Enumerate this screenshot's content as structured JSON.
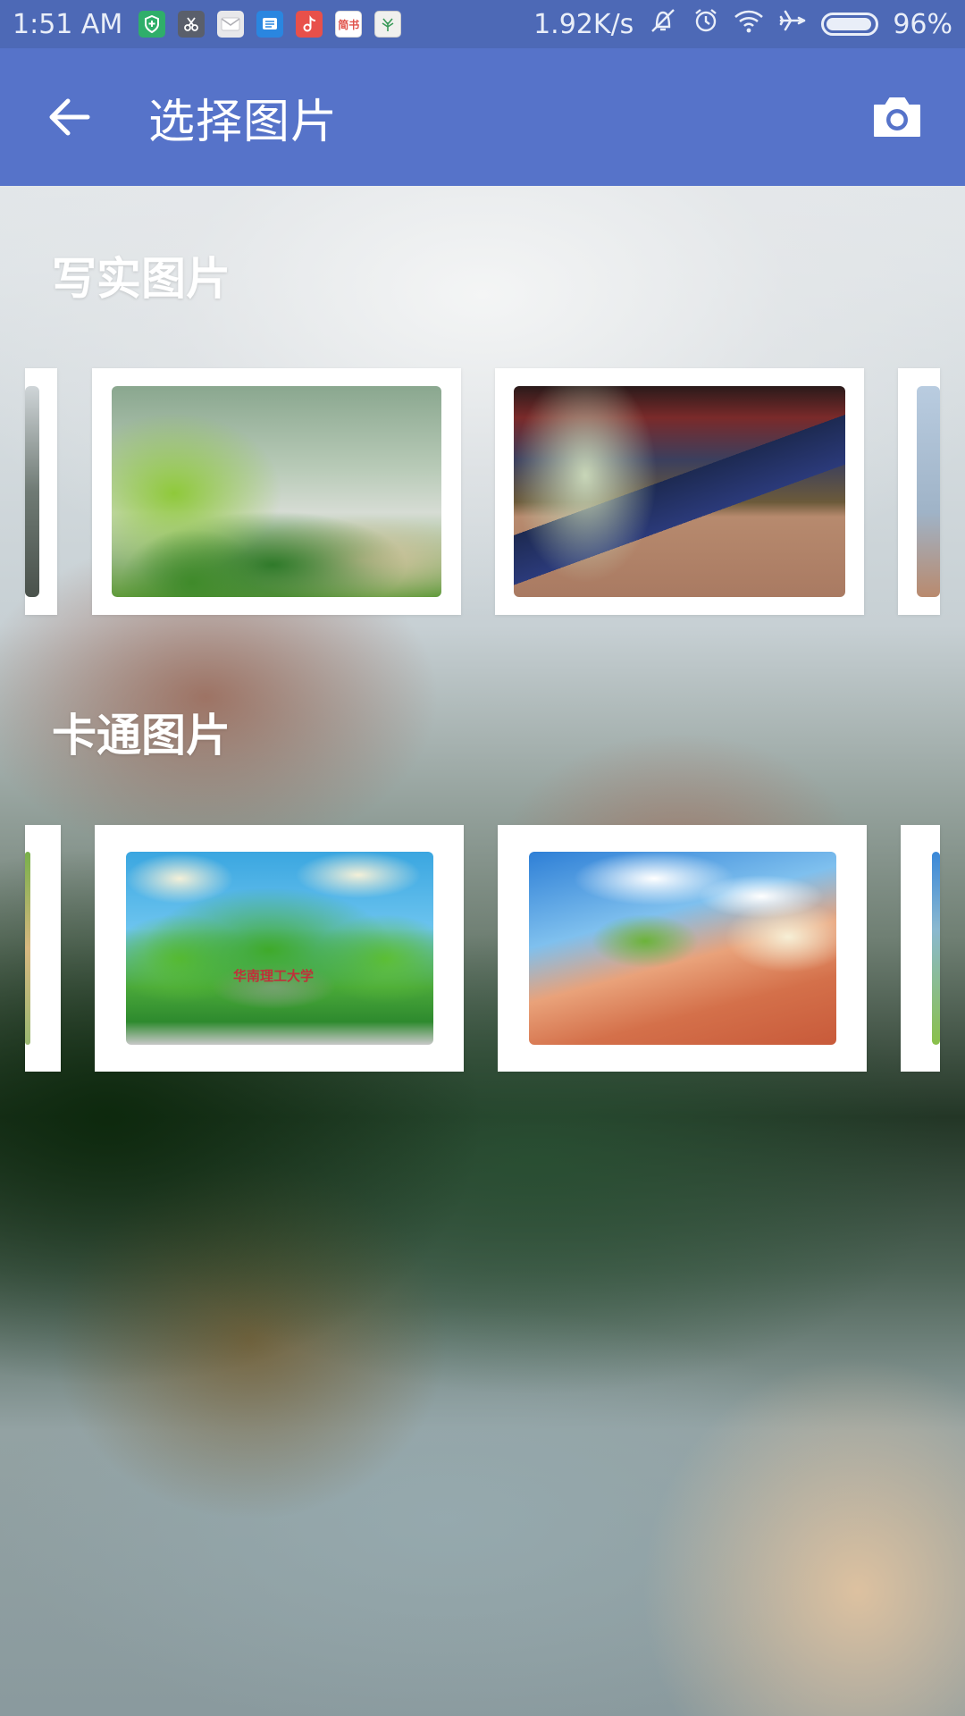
{
  "status_bar": {
    "time": "1:51 AM",
    "network_speed": "1.92K/s",
    "battery_percent": "96%",
    "battery_level": 0.96,
    "notification_icons": [
      {
        "name": "shield-app-icon",
        "color": "#2fae6a",
        "glyph": "⛨"
      },
      {
        "name": "scissors-app-icon",
        "color": "#5a5f6b",
        "glyph": "✂"
      },
      {
        "name": "mail-app-icon",
        "color": "#e8e8ea",
        "glyph": "✉"
      },
      {
        "name": "messages-app-icon",
        "color": "#2a86e0",
        "glyph": "▤"
      },
      {
        "name": "music-app-icon",
        "color": "#e8504a",
        "glyph": "♪"
      },
      {
        "name": "jianshu-app-icon",
        "color": "#ffffff",
        "glyph": "简书"
      },
      {
        "name": "leaf-app-icon",
        "color": "#f0f0ee",
        "glyph": "❦"
      }
    ]
  },
  "app_bar": {
    "title": "选择图片",
    "back_icon": "arrow-left-icon",
    "camera_icon": "camera-icon"
  },
  "sections": [
    {
      "title": "写实图片",
      "images": [
        "edge-left",
        "plant",
        "street",
        "edge-right"
      ]
    },
    {
      "title": "卡通图片",
      "images": [
        "edge-left",
        "campus-sign",
        "campus-stairs",
        "edge-right"
      ]
    }
  ],
  "cartoon_sign_text": "华南理工大学",
  "colors": {
    "status_bar": "#4d69b6",
    "app_bar": "#5673c9",
    "card": "#ffffff"
  }
}
